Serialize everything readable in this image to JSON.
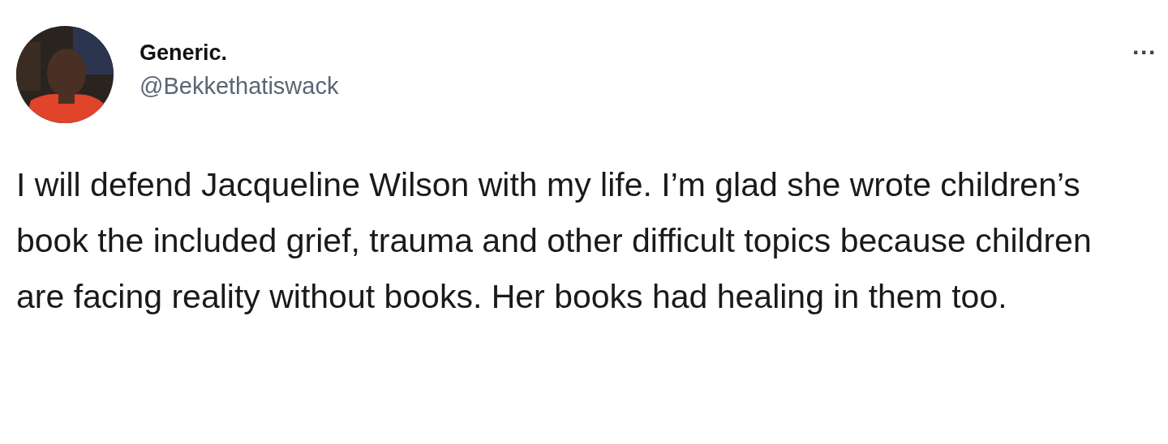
{
  "tweet": {
    "display_name": "Generic.",
    "handle": "@Bekkethatiswack",
    "more": "···",
    "text": "I will defend Jacqueline Wilson with my life. I’m glad she wrote children’s book the included grief, trauma and other difficult topics because children are facing reality without books. Her books had healing in them too."
  }
}
